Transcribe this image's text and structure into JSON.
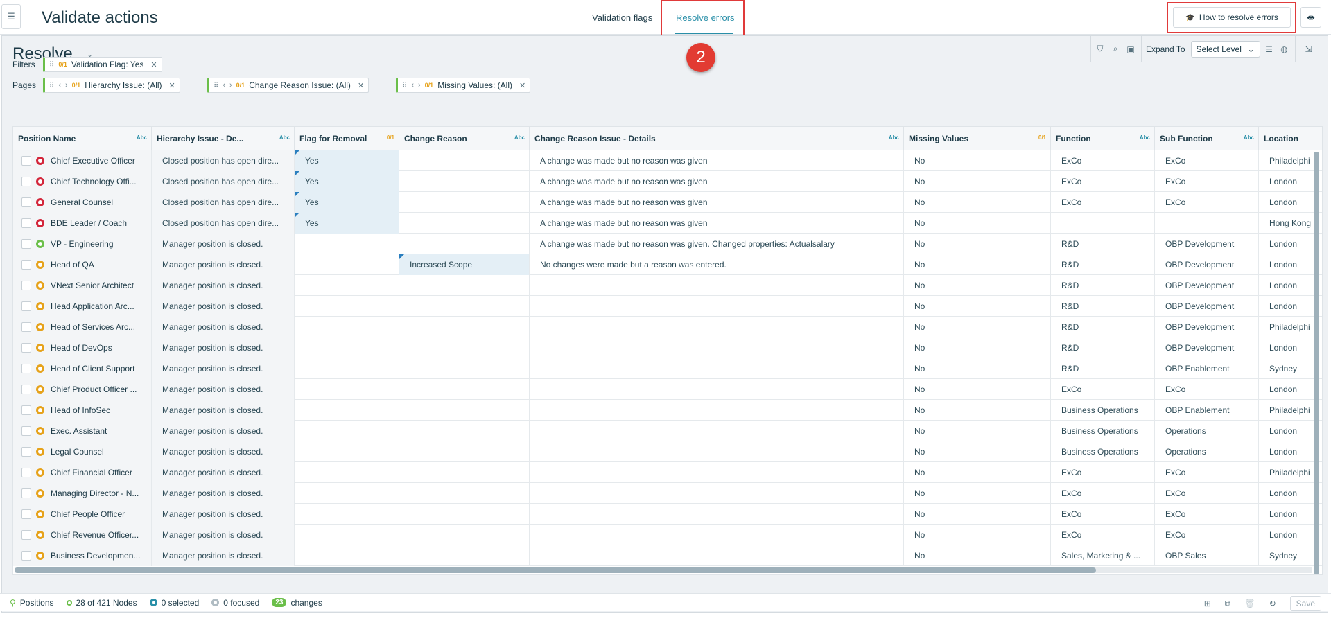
{
  "header": {
    "title": "Validate actions",
    "tabs": [
      "Validation flags",
      "Resolve errors"
    ],
    "active_tab": "Resolve errors",
    "help_button": "How to resolve errors",
    "step_badge": "2"
  },
  "panel": {
    "title": "Resolve",
    "expand_to_label": "Expand To",
    "select_level": "Select Level",
    "filters_label": "Filters",
    "pages_label": "Pages",
    "filters": [
      {
        "ratio": "0/1",
        "label": "Validation Flag: Yes"
      }
    ],
    "pages": [
      {
        "ratio": "0/1",
        "label": "Hierarchy Issue: (All)"
      },
      {
        "ratio": "0/1",
        "label": "Change Reason Issue: (All)"
      },
      {
        "ratio": "0/1",
        "label": "Missing Values: (All)"
      }
    ]
  },
  "columns": [
    {
      "label": "Position Name",
      "tag": "Abc"
    },
    {
      "label": "Hierarchy Issue - De...",
      "tag": "Abc"
    },
    {
      "label": "Flag for Removal",
      "tag": "0/1"
    },
    {
      "label": "Change Reason",
      "tag": "Abc"
    },
    {
      "label": "Change Reason Issue - Details",
      "tag": "Abc"
    },
    {
      "label": "Missing Values",
      "tag": "0/1"
    },
    {
      "label": "Function",
      "tag": "Abc"
    },
    {
      "label": "Sub Function",
      "tag": "Abc"
    },
    {
      "label": "Location",
      "tag": ""
    }
  ],
  "rows": [
    {
      "status": "red",
      "name": "Chief Executive Officer",
      "hier": "Closed position has open dire...",
      "flag": "Yes",
      "reason": "",
      "details": "A change was made but no reason was given",
      "missing": "No",
      "function": "ExCo",
      "sub": "ExCo",
      "location": "Philadelphi"
    },
    {
      "status": "red",
      "name": "Chief Technology Offi...",
      "hier": "Closed position has open dire...",
      "flag": "Yes",
      "reason": "",
      "details": "A change was made but no reason was given",
      "missing": "No",
      "function": "ExCo",
      "sub": "ExCo",
      "location": "London"
    },
    {
      "status": "red",
      "name": "General Counsel",
      "hier": "Closed position has open dire...",
      "flag": "Yes",
      "reason": "",
      "details": "A change was made but no reason was given",
      "missing": "No",
      "function": "ExCo",
      "sub": "ExCo",
      "location": "London"
    },
    {
      "status": "red",
      "name": "BDE Leader / Coach",
      "hier": "Closed position has open dire...",
      "flag": "Yes",
      "reason": "",
      "details": "A change was made but no reason was given",
      "missing": "No",
      "function": "",
      "sub": "",
      "location": "Hong Kong"
    },
    {
      "status": "green",
      "name": "VP - Engineering",
      "hier": "Manager position is closed.",
      "flag": "",
      "reason": "",
      "details": "A change was made but no reason was given. Changed properties: Actualsalary",
      "missing": "No",
      "function": "R&D",
      "sub": "OBP Development",
      "location": "London"
    },
    {
      "status": "orange",
      "name": "Head of QA",
      "hier": "Manager position is closed.",
      "flag": "",
      "reason": "Increased Scope",
      "details": "No changes were made but a reason was entered.",
      "missing": "No",
      "function": "R&D",
      "sub": "OBP Development",
      "location": "London"
    },
    {
      "status": "orange",
      "name": "VNext Senior Architect",
      "hier": "Manager position is closed.",
      "flag": "",
      "reason": "",
      "details": "",
      "missing": "No",
      "function": "R&D",
      "sub": "OBP Development",
      "location": "London"
    },
    {
      "status": "orange",
      "name": "Head Application Arc...",
      "hier": "Manager position is closed.",
      "flag": "",
      "reason": "",
      "details": "",
      "missing": "No",
      "function": "R&D",
      "sub": "OBP Development",
      "location": "London"
    },
    {
      "status": "orange",
      "name": "Head of Services Arc...",
      "hier": "Manager position is closed.",
      "flag": "",
      "reason": "",
      "details": "",
      "missing": "No",
      "function": "R&D",
      "sub": "OBP Development",
      "location": "Philadelphi"
    },
    {
      "status": "orange",
      "name": "Head of DevOps",
      "hier": "Manager position is closed.",
      "flag": "",
      "reason": "",
      "details": "",
      "missing": "No",
      "function": "R&D",
      "sub": "OBP Development",
      "location": "London"
    },
    {
      "status": "orange",
      "name": "Head of Client Support",
      "hier": "Manager position is closed.",
      "flag": "",
      "reason": "",
      "details": "",
      "missing": "No",
      "function": "R&D",
      "sub": "OBP Enablement",
      "location": "Sydney"
    },
    {
      "status": "orange",
      "name": "Chief Product Officer ...",
      "hier": "Manager position is closed.",
      "flag": "",
      "reason": "",
      "details": "",
      "missing": "No",
      "function": "ExCo",
      "sub": "ExCo",
      "location": "London"
    },
    {
      "status": "orange",
      "name": "Head of InfoSec",
      "hier": "Manager position is closed.",
      "flag": "",
      "reason": "",
      "details": "",
      "missing": "No",
      "function": "Business Operations",
      "sub": "OBP Enablement",
      "location": "Philadelphi"
    },
    {
      "status": "orange",
      "name": "Exec. Assistant",
      "hier": "Manager position is closed.",
      "flag": "",
      "reason": "",
      "details": "",
      "missing": "No",
      "function": "Business Operations",
      "sub": "Operations",
      "location": "London"
    },
    {
      "status": "orange",
      "name": "Legal Counsel",
      "hier": "Manager position is closed.",
      "flag": "",
      "reason": "",
      "details": "",
      "missing": "No",
      "function": "Business Operations",
      "sub": "Operations",
      "location": "London"
    },
    {
      "status": "orange",
      "name": "Chief Financial Officer",
      "hier": "Manager position is closed.",
      "flag": "",
      "reason": "",
      "details": "",
      "missing": "No",
      "function": "ExCo",
      "sub": "ExCo",
      "location": "Philadelphi"
    },
    {
      "status": "orange",
      "name": "Managing Director - N...",
      "hier": "Manager position is closed.",
      "flag": "",
      "reason": "",
      "details": "",
      "missing": "No",
      "function": "ExCo",
      "sub": "ExCo",
      "location": "London"
    },
    {
      "status": "orange",
      "name": "Chief People Officer",
      "hier": "Manager position is closed.",
      "flag": "",
      "reason": "",
      "details": "",
      "missing": "No",
      "function": "ExCo",
      "sub": "ExCo",
      "location": "London"
    },
    {
      "status": "orange",
      "name": "Chief Revenue Officer...",
      "hier": "Manager position is closed.",
      "flag": "",
      "reason": "",
      "details": "",
      "missing": "No",
      "function": "ExCo",
      "sub": "ExCo",
      "location": "London"
    },
    {
      "status": "orange",
      "name": "Business Developmen...",
      "hier": "Manager position is closed.",
      "flag": "",
      "reason": "",
      "details": "",
      "missing": "No",
      "function": "Sales, Marketing & ...",
      "sub": "OBP Sales",
      "location": "Sydney"
    }
  ],
  "statusbar": {
    "positions": "Positions",
    "nodes": "28 of 421 Nodes",
    "selected": "0 selected",
    "focused": "0 focused",
    "changes_count": "23",
    "changes_label": "changes",
    "save": "Save"
  },
  "colors": {
    "accent": "#2a8fa8",
    "highlight_box": "#e03a3a",
    "status_red": "#d3253a",
    "status_green": "#6bbf4a",
    "status_orange": "#e6a21a"
  }
}
